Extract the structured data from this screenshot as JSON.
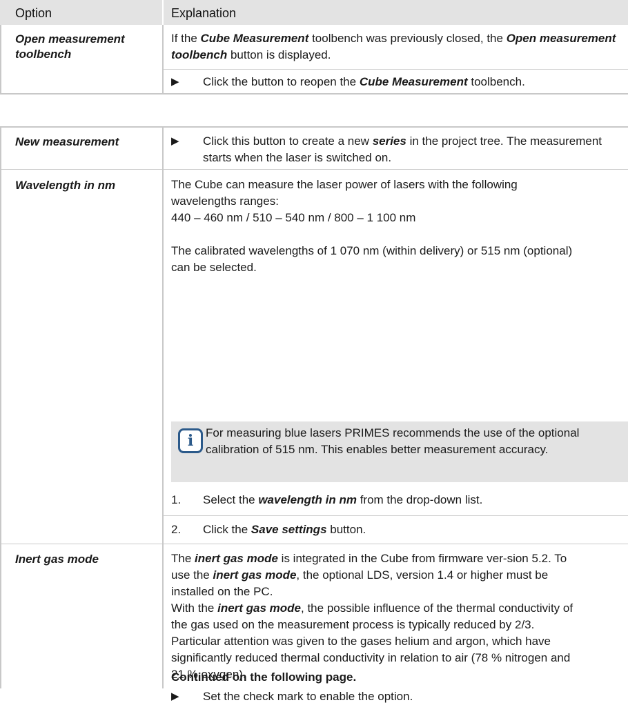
{
  "table1": {
    "header_option": "Option",
    "header_explanation": "Explanation",
    "row_open": {
      "option": "Open measurement toolbench",
      "text_a": "If the ",
      "text_b": "Cube Measurement",
      "text_c": " toolbench was previously closed, the ",
      "text_d": "Open measurement toolbench",
      "text_e": " button is displayed.",
      "step_a": "Click the button to reopen the ",
      "step_b": "Cube Measurement",
      "step_c": " toolbench."
    }
  },
  "table2": {
    "row_new": {
      "option": "New measurement",
      "step_a": "Click this button to create a new ",
      "step_b": "series",
      "step_c": " in the project tree. The measurement starts when the laser is switched on."
    },
    "row_wavelength": {
      "option": "Wavelength in nm",
      "para1": "The Cube can measure the laser power of lasers with the following wavelengths ranges:",
      "para1_ranges": "440 – 460 nm / 510 – 540 nm / 800 – 1 100 nm",
      "para2": "The calibrated wavelengths of 1 070 nm (within delivery) or 515 nm (optional) can be selected.",
      "info_icon": "info-icon",
      "info_text": "For measuring blue lasers PRIMES recommends the use of the optional calibration of 515 nm. This enables better measurement accuracy.",
      "step1_num": "1.",
      "step1_a": "Select the ",
      "step1_b": "wavelength in nm",
      "step1_c": " from the drop-down list.",
      "step2_num": "2.",
      "step2_a": "Click the ",
      "step2_b": "Save settings",
      "step2_c": " button."
    },
    "row_inert": {
      "option": "Inert gas mode",
      "p1_a": "The ",
      "p1_b": "inert gas mode",
      "p1_c": " is integrated in the Cube from firmware ver-sion 5.2. To use the ",
      "p1_d": "inert gas mode",
      "p1_e": ", the optional LDS, version 1.4 or higher must be installed on the PC.",
      "p2_a": "With the ",
      "p2_b": "inert gas mode",
      "p2_c": ", the possible influence of the thermal conductivity of the gas used on the measurement process is typically reduced by 2/3.",
      "p3": "Particular attention was given to the gases helium and argon, which have significantly reduced thermal conductivity in relation to air (78 % nitrogen and 21 % oxygen).",
      "step": "Set the check mark to enable the option.",
      "continued": "Continued on the following page."
    }
  },
  "arrow_symbol": "▶"
}
